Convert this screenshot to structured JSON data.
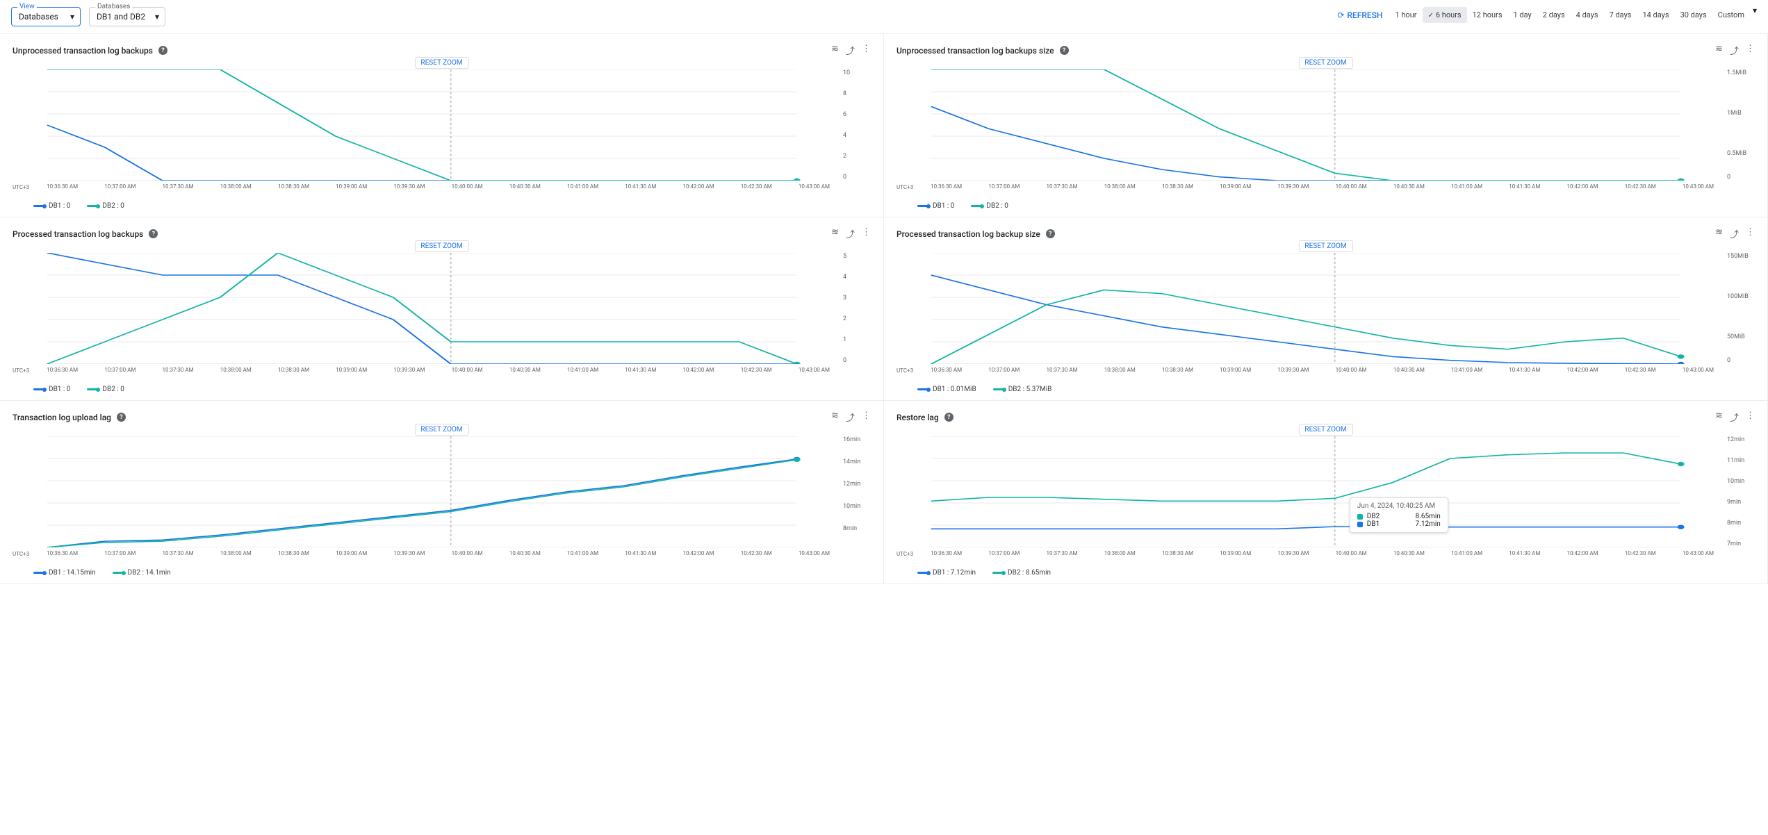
{
  "filters": {
    "view_label": "View",
    "view_value": "Databases",
    "db_label": "Databases",
    "db_value": "DB1 and DB2"
  },
  "toolbar": {
    "refresh": "REFRESH",
    "ranges": [
      "1 hour",
      "6 hours",
      "12 hours",
      "1 day",
      "2 days",
      "4 days",
      "7 days",
      "14 days",
      "30 days",
      "Custom"
    ],
    "active_range": "6 hours"
  },
  "common": {
    "reset_zoom": "RESET ZOOM",
    "x_prefix": "UTC+3",
    "x_ticks": [
      "10:36:30 AM",
      "10:37:00 AM",
      "10:37:30 AM",
      "10:38:00 AM",
      "10:38:30 AM",
      "10:39:00 AM",
      "10:39:30 AM",
      "10:40:00 AM",
      "10:40:30 AM",
      "10:41:00 AM",
      "10:41:30 AM",
      "10:42:00 AM",
      "10:42:30 AM",
      "10:43:00 AM"
    ]
  },
  "colors": {
    "s1": "#1a73e8",
    "s2": "#12b5a5"
  },
  "charts": [
    {
      "id": "c1",
      "title": "Unprocessed transaction log backups",
      "y_ticks": [
        "10",
        "8",
        "6",
        "4",
        "2",
        "0"
      ],
      "legend": [
        {
          "name": "DB1",
          "value": "0"
        },
        {
          "name": "DB2",
          "value": "0"
        }
      ]
    },
    {
      "id": "c2",
      "title": "Unprocessed transaction log backups size",
      "y_ticks": [
        "1.5MiB",
        "",
        "1MiB",
        "",
        "0.5MiB",
        "0"
      ],
      "legend": [
        {
          "name": "DB1",
          "value": "0"
        },
        {
          "name": "DB2",
          "value": "0"
        }
      ]
    },
    {
      "id": "c3",
      "title": "Processed transaction log backups",
      "y_ticks": [
        "5",
        "4",
        "3",
        "2",
        "1",
        "0"
      ],
      "legend": [
        {
          "name": "DB1",
          "value": "0"
        },
        {
          "name": "DB2",
          "value": "0"
        }
      ]
    },
    {
      "id": "c4",
      "title": "Processed transaction log backup size",
      "y_ticks": [
        "150MiB",
        "",
        "100MiB",
        "",
        "50MiB",
        "0"
      ],
      "legend": [
        {
          "name": "DB1",
          "value": "0.01MiB"
        },
        {
          "name": "DB2",
          "value": "5.37MiB"
        }
      ]
    },
    {
      "id": "c5",
      "title": "Transaction log upload lag",
      "y_ticks": [
        "16min",
        "14min",
        "12min",
        "10min",
        "8min",
        ""
      ],
      "legend": [
        {
          "name": "DB1",
          "value": "14.15min"
        },
        {
          "name": "DB2",
          "value": "14.1min"
        }
      ]
    },
    {
      "id": "c6",
      "title": "Restore lag",
      "y_ticks": [
        "12min",
        "11min",
        "10min",
        "9min",
        "8min",
        "7min"
      ],
      "legend": [
        {
          "name": "DB1",
          "value": "7.12min"
        },
        {
          "name": "DB2",
          "value": "8.65min"
        }
      ],
      "tooltip": {
        "time": "Jun 4, 2024, 10:40:25 AM",
        "rows": [
          {
            "name": "DB2",
            "val": "8.65min",
            "color": "#12b5a5"
          },
          {
            "name": "DB1",
            "val": "7.12min",
            "color": "#1a73e8"
          }
        ]
      }
    }
  ],
  "chart_data": [
    {
      "id": "c1",
      "type": "line",
      "title": "Unprocessed transaction log backups",
      "xlabel": "UTC+3",
      "ylabel": "",
      "ylim": [
        0,
        10
      ],
      "x": [
        "10:36:30",
        "10:37:00",
        "10:37:30",
        "10:38:00",
        "10:38:30",
        "10:39:00",
        "10:39:30",
        "10:40:00",
        "10:40:30",
        "10:41:00",
        "10:41:30",
        "10:42:00",
        "10:42:30",
        "10:43:00"
      ],
      "series": [
        {
          "name": "DB1",
          "values": [
            5,
            3,
            0,
            0,
            0,
            0,
            0,
            0,
            0,
            0,
            0,
            0,
            0,
            0
          ]
        },
        {
          "name": "DB2",
          "values": [
            10,
            10,
            10,
            10,
            7,
            4,
            2,
            0,
            0,
            0,
            0,
            0,
            0,
            0
          ]
        }
      ]
    },
    {
      "id": "c2",
      "type": "line",
      "title": "Unprocessed transaction log backups size",
      "xlabel": "UTC+3",
      "ylabel": "MiB",
      "ylim": [
        0,
        1.5
      ],
      "x": [
        "10:36:30",
        "10:37:00",
        "10:37:30",
        "10:38:00",
        "10:38:30",
        "10:39:00",
        "10:39:30",
        "10:40:00",
        "10:40:30",
        "10:41:00",
        "10:41:30",
        "10:42:00",
        "10:42:30",
        "10:43:00"
      ],
      "series": [
        {
          "name": "DB1",
          "values": [
            1.0,
            0.7,
            0.5,
            0.3,
            0.15,
            0.05,
            0,
            0,
            0,
            0,
            0,
            0,
            0,
            0
          ]
        },
        {
          "name": "DB2",
          "values": [
            1.5,
            1.5,
            1.5,
            1.5,
            1.1,
            0.7,
            0.4,
            0.1,
            0,
            0,
            0,
            0,
            0,
            0
          ]
        }
      ]
    },
    {
      "id": "c3",
      "type": "line",
      "title": "Processed transaction log backups",
      "xlabel": "UTC+3",
      "ylabel": "",
      "ylim": [
        0,
        5
      ],
      "x": [
        "10:36:30",
        "10:37:00",
        "10:37:30",
        "10:38:00",
        "10:38:30",
        "10:39:00",
        "10:39:30",
        "10:40:00",
        "10:40:30",
        "10:41:00",
        "10:41:30",
        "10:42:00",
        "10:42:30",
        "10:43:00"
      ],
      "series": [
        {
          "name": "DB1",
          "values": [
            5,
            4.5,
            4,
            4,
            4,
            3,
            2,
            0,
            0,
            0,
            0,
            0,
            0,
            0
          ]
        },
        {
          "name": "DB2",
          "values": [
            0,
            1,
            2,
            3,
            5,
            4,
            3,
            1,
            1,
            1,
            1,
            1,
            1,
            0
          ]
        }
      ]
    },
    {
      "id": "c4",
      "type": "line",
      "title": "Processed transaction log backup size",
      "xlabel": "UTC+3",
      "ylabel": "MiB",
      "ylim": [
        0,
        150
      ],
      "x": [
        "10:36:30",
        "10:37:00",
        "10:37:30",
        "10:38:00",
        "10:38:30",
        "10:39:00",
        "10:39:30",
        "10:40:00",
        "10:40:30",
        "10:41:00",
        "10:41:30",
        "10:42:00",
        "10:42:30",
        "10:43:00"
      ],
      "series": [
        {
          "name": "DB1",
          "values": [
            120,
            100,
            80,
            65,
            50,
            40,
            30,
            20,
            10,
            5,
            2,
            1,
            0.5,
            0.01
          ]
        },
        {
          "name": "DB2",
          "values": [
            0,
            40,
            80,
            100,
            95,
            80,
            65,
            50,
            35,
            25,
            20,
            30,
            35,
            10
          ]
        }
      ]
    },
    {
      "id": "c5",
      "type": "line",
      "title": "Transaction log upload lag",
      "xlabel": "UTC+3",
      "ylabel": "min",
      "ylim": [
        7,
        16
      ],
      "x": [
        "10:36:30",
        "10:37:00",
        "10:37:30",
        "10:38:00",
        "10:38:30",
        "10:39:00",
        "10:39:30",
        "10:40:00",
        "10:40:30",
        "10:41:00",
        "10:41:30",
        "10:42:00",
        "10:42:30",
        "10:43:00"
      ],
      "series": [
        {
          "name": "DB1",
          "values": [
            7,
            7.5,
            7.6,
            8,
            8.5,
            9,
            9.5,
            10,
            10.8,
            11.5,
            12,
            12.8,
            13.5,
            14.15
          ]
        },
        {
          "name": "DB2",
          "values": [
            7,
            7.4,
            7.5,
            7.9,
            8.4,
            8.9,
            9.4,
            9.9,
            10.7,
            11.4,
            11.9,
            12.7,
            13.4,
            14.1
          ]
        }
      ]
    },
    {
      "id": "c6",
      "type": "line",
      "title": "Restore lag",
      "xlabel": "UTC+3",
      "ylabel": "min",
      "ylim": [
        6,
        12
      ],
      "x": [
        "10:36:30",
        "10:37:00",
        "10:37:30",
        "10:38:00",
        "10:38:30",
        "10:39:00",
        "10:39:30",
        "10:40:00",
        "10:40:30",
        "10:41:00",
        "10:41:30",
        "10:42:00",
        "10:42:30",
        "10:43:00"
      ],
      "series": [
        {
          "name": "DB1",
          "values": [
            7,
            7,
            7,
            7,
            7,
            7,
            7,
            7.12,
            7.1,
            7.1,
            7.1,
            7.1,
            7.1,
            7.1
          ]
        },
        {
          "name": "DB2",
          "values": [
            8.5,
            8.7,
            8.7,
            8.6,
            8.5,
            8.5,
            8.5,
            8.65,
            9.5,
            10.8,
            11,
            11.1,
            11.1,
            10.5
          ]
        }
      ]
    }
  ]
}
